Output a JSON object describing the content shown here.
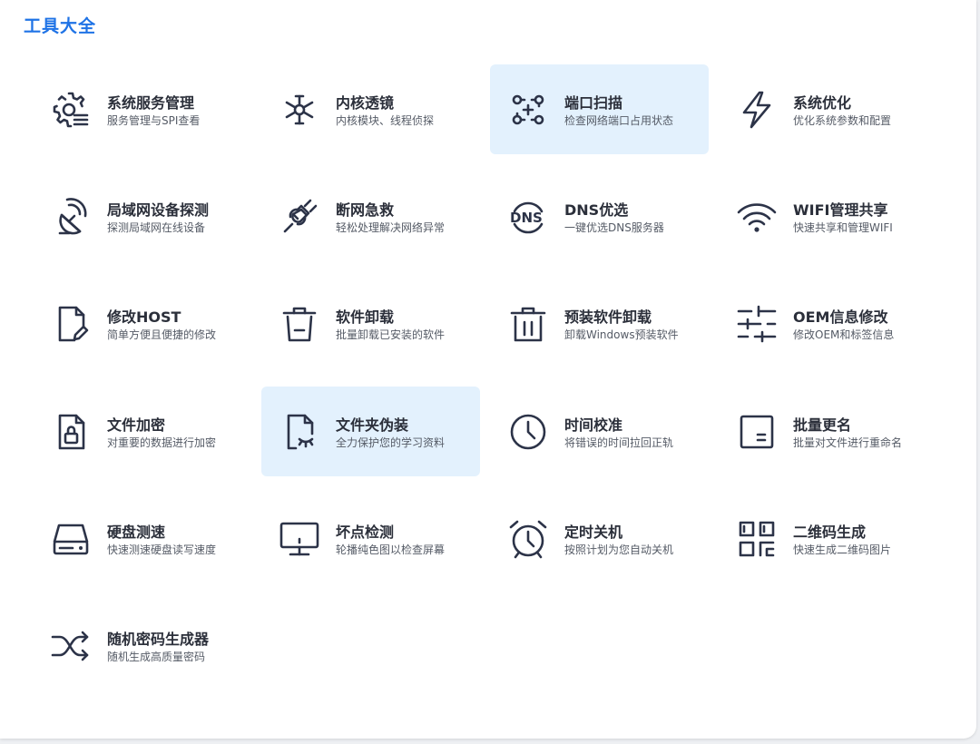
{
  "section": {
    "title": "工具大全"
  },
  "tools": [
    {
      "name": "系统服务管理",
      "desc": "服务管理与SPI查看",
      "icon": "gear-list-icon",
      "highlighted": false
    },
    {
      "name": "内核透镜",
      "desc": "内核模块、线程侦探",
      "icon": "network-hub-icon",
      "highlighted": false
    },
    {
      "name": "端口扫描",
      "desc": "检查网络端口占用状态",
      "icon": "port-scan-icon",
      "highlighted": true
    },
    {
      "name": "系统优化",
      "desc": "优化系统参数和配置",
      "icon": "lightning-icon",
      "highlighted": false
    },
    {
      "name": "局域网设备探测",
      "desc": "探测局域网在线设备",
      "icon": "satellite-dish-icon",
      "highlighted": false
    },
    {
      "name": "断网急救",
      "desc": "轻松处理解决网络异常",
      "icon": "plug-icon",
      "highlighted": false
    },
    {
      "name": "DNS优选",
      "desc": "一键优选DNS服务器",
      "icon": "dns-icon",
      "highlighted": false
    },
    {
      "name": "WIFI管理共享",
      "desc": "快速共享和管理WIFI",
      "icon": "wifi-icon",
      "highlighted": false
    },
    {
      "name": "修改HOST",
      "desc": "简单方便且便捷的修改",
      "icon": "file-edit-icon",
      "highlighted": false
    },
    {
      "name": "软件卸载",
      "desc": "批量卸载已安装的软件",
      "icon": "trash-icon",
      "highlighted": false
    },
    {
      "name": "预装软件卸载",
      "desc": "卸载Windows预装软件",
      "icon": "trash-lines-icon",
      "highlighted": false
    },
    {
      "name": "OEM信息修改",
      "desc": "修改OEM和标签信息",
      "icon": "sliders-icon",
      "highlighted": false
    },
    {
      "name": "文件加密",
      "desc": "对重要的数据进行加密",
      "icon": "file-lock-icon",
      "highlighted": false
    },
    {
      "name": "文件夹伪装",
      "desc": "全力保护您的学习资料",
      "icon": "file-hidden-icon",
      "highlighted": true
    },
    {
      "name": "时间校准",
      "desc": "将错误的时间拉回正轨",
      "icon": "clock-icon",
      "highlighted": false
    },
    {
      "name": "批量更名",
      "desc": "批量对文件进行重命名",
      "icon": "rename-icon",
      "highlighted": false
    },
    {
      "name": "硬盘测速",
      "desc": "快速测速硬盘读写速度",
      "icon": "hard-drive-icon",
      "highlighted": false
    },
    {
      "name": "坏点检测",
      "desc": "轮播纯色图以检查屏幕",
      "icon": "monitor-icon",
      "highlighted": false
    },
    {
      "name": "定时关机",
      "desc": "按照计划为您自动关机",
      "icon": "alarm-clock-icon",
      "highlighted": false
    },
    {
      "name": "二维码生成",
      "desc": "快速生成二维码图片",
      "icon": "qr-code-icon",
      "highlighted": false
    },
    {
      "name": "随机密码生成器",
      "desc": "随机生成高质量密码",
      "icon": "shuffle-icon",
      "highlighted": false
    }
  ]
}
